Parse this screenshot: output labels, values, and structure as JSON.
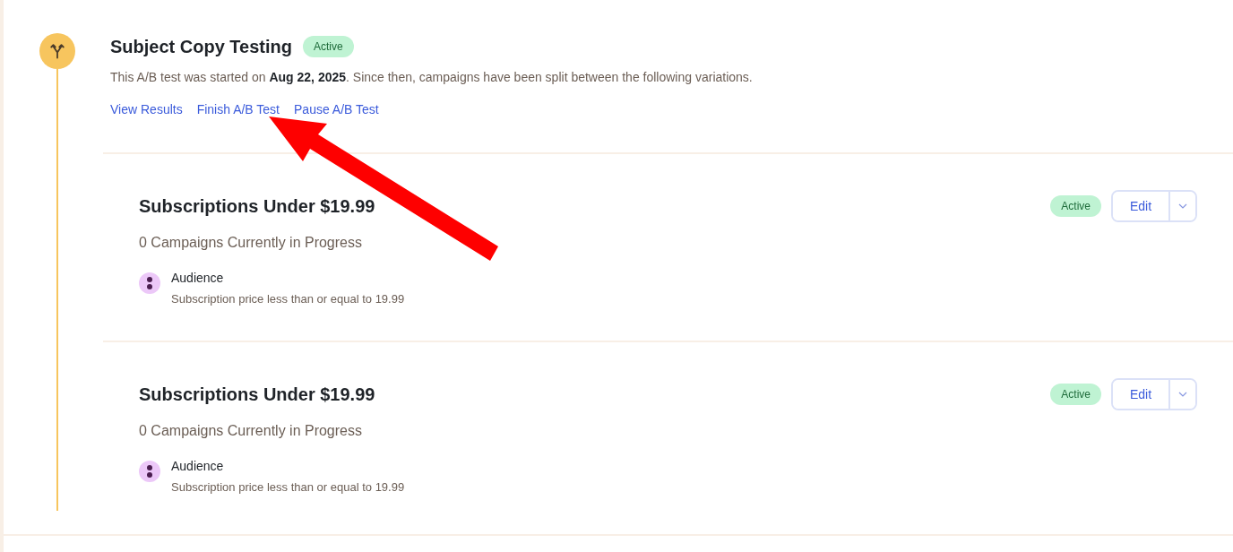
{
  "test": {
    "title": "Subject Copy Testing",
    "status": "Active",
    "description": "This A/B test was started on **Aug 22, 2025**. Since then, campaigns have been split between the following variations.",
    "links": [
      "View Results",
      "Finish A/B Test",
      "Pause A/B Test"
    ]
  },
  "variations": [
    {
      "title": "Subscriptions Under $19.99",
      "campaigns": "0 Campaigns Currently in Progress",
      "status": "Active",
      "edit": "Edit",
      "criteria": {
        "label": "Audience",
        "text": "Subscription price less than or equal to 19.99"
      }
    },
    {
      "title": "Subscriptions Under $19.99",
      "campaigns": "0 Campaigns Currently in Progress",
      "status": "Active",
      "edit": "Edit",
      "criteria": {
        "label": "Audience",
        "text": "Subscription price less than or equal to 19.99"
      }
    }
  ]
}
